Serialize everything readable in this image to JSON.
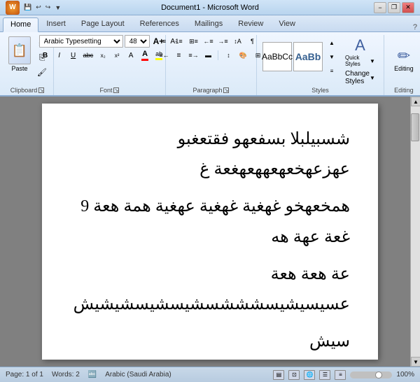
{
  "titlebar": {
    "title": "Document1 - Microsoft Word",
    "logo": "W",
    "quickaccess": [
      "save",
      "undo",
      "redo"
    ],
    "min_label": "−",
    "max_label": "□",
    "close_label": "✕",
    "restore_label": "❐"
  },
  "tabs": [
    {
      "label": "Home",
      "active": true
    },
    {
      "label": "Insert",
      "active": false
    },
    {
      "label": "Page Layout",
      "active": false
    },
    {
      "label": "References",
      "active": false
    },
    {
      "label": "Mailings",
      "active": false
    },
    {
      "label": "Review",
      "active": false
    },
    {
      "label": "View",
      "active": false
    }
  ],
  "ribbon": {
    "groups": [
      {
        "label": "Clipboard",
        "expand": true
      },
      {
        "label": "Font",
        "expand": true
      },
      {
        "label": "Paragraph",
        "expand": true
      },
      {
        "label": "Styles",
        "expand": false
      },
      {
        "label": "Editing",
        "expand": false
      }
    ],
    "paste_label": "Paste",
    "font_name": "Arabic Typesetting",
    "font_size": "48",
    "bold": "B",
    "italic": "I",
    "underline": "U",
    "strikethrough": "abc",
    "subscript": "x₂",
    "superscript": "x²",
    "font_color": "A",
    "highlight": "ab",
    "clear_format": "A",
    "quick_styles_label": "Quick Styles",
    "change_styles_label": "Change Styles",
    "editing_label": "Editing"
  },
  "document": {
    "line1": "شسبيلبلا بسفعهو فقتعغبو عهزعهخعهعههعهغعة غ",
    "line2": "همخعهخو غهغية غهغية عهغية همة هعة 9 غعة عهة هه",
    "line3": "عة هعة هعة عسيسيشيسشششسشيسشيسشيشيش",
    "line4": "سيش"
  },
  "statusbar": {
    "page": "Page: 1 of 1",
    "words": "Words: 2",
    "language": "Arabic (Saudi Arabia)",
    "zoom": "100%"
  }
}
